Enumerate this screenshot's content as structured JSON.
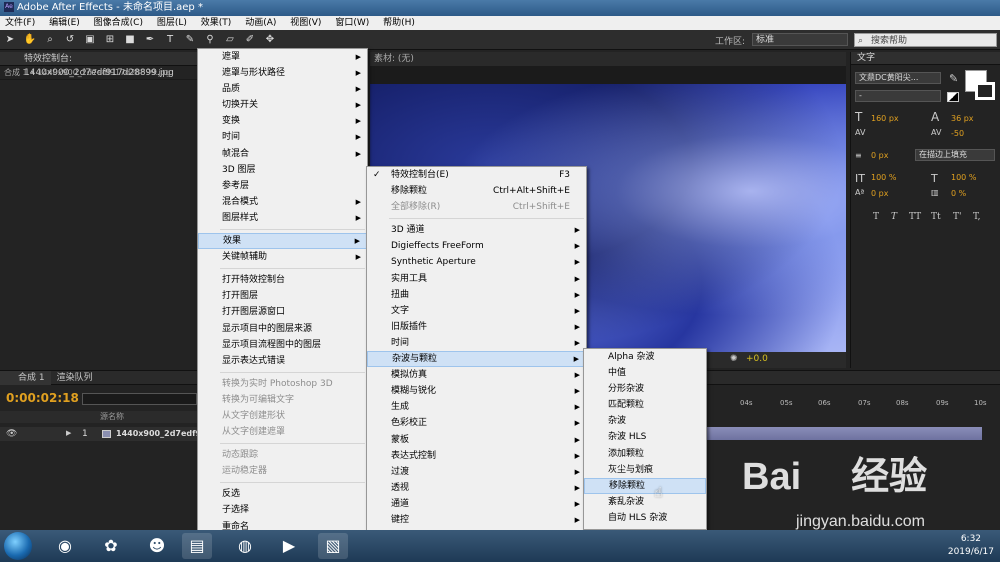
{
  "window": {
    "title": "Adobe After Effects - 未命名项目.aep *",
    "app_icon": "Ae"
  },
  "menubar": [
    "文件(F)",
    "编辑(E)",
    "图像合成(C)",
    "图层(L)",
    "效果(T)",
    "动画(A)",
    "视图(V)",
    "窗口(W)",
    "帮助(H)"
  ],
  "toolbar": {
    "workspace_label": "工作区:",
    "workspace_value": "标准",
    "search_placeholder": "搜索帮助"
  },
  "project": {
    "tab": "特效控制台: 1440x900_2d7edf917d28899.jpg",
    "sub": "合成 1 • 1440x900_2d7edf917d28899.jpg"
  },
  "viewer": {
    "header": "素材: (无)",
    "offset": "+0.0"
  },
  "text_panel": {
    "title": "文字",
    "font": "文鼎DC黄阳尖...",
    "style": "-",
    "size": "160 px",
    "leading": "36 px",
    "tracking": "-50",
    "stroke_width": "0 px",
    "stroke_mode": "在描边上填充",
    "vscale": "100 %",
    "hscale": "100 %",
    "baseline": "0 px",
    "tsume": "0 %",
    "styles": [
      "T",
      "T",
      "TT",
      "Tt",
      "T'",
      "T,"
    ]
  },
  "timeline": {
    "tabs": [
      "合成 1",
      "渲染队列"
    ],
    "timecode": "0:00:02:18",
    "col_source": "源名称",
    "layer_num": "1",
    "layer_name": "1440x900_2d7edf9",
    "ruler": [
      "04s",
      "05s",
      "06s",
      "07s",
      "08s",
      "09s",
      "10s"
    ]
  },
  "layer_menu": [
    {
      "label": "遮罩",
      "arrow": true
    },
    {
      "label": "遮罩与形状路径",
      "arrow": true
    },
    {
      "label": "品质",
      "arrow": true
    },
    {
      "label": "切换开关",
      "arrow": true
    },
    {
      "label": "变换",
      "arrow": true
    },
    {
      "label": "时间",
      "arrow": true
    },
    {
      "label": "帧混合",
      "arrow": true
    },
    {
      "label": "3D 图层"
    },
    {
      "label": "参考层"
    },
    {
      "label": "混合模式",
      "arrow": true
    },
    {
      "label": "图层样式",
      "arrow": true
    },
    {
      "sep": true
    },
    {
      "label": "效果",
      "arrow": true,
      "highlight": true
    },
    {
      "label": "关键帧辅助",
      "arrow": true
    },
    {
      "sep": true
    },
    {
      "label": "打开特效控制台"
    },
    {
      "label": "打开图层"
    },
    {
      "label": "打开图层源窗口"
    },
    {
      "label": "显示项目中的图层来源"
    },
    {
      "label": "显示项目流程图中的图层"
    },
    {
      "label": "显示表达式错误"
    },
    {
      "sep": true
    },
    {
      "label": "转换为实时 Photoshop 3D",
      "disabled": true
    },
    {
      "label": "转换为可编辑文字",
      "disabled": true
    },
    {
      "label": "从文字创建形状",
      "disabled": true
    },
    {
      "label": "从文字创建遮罩",
      "disabled": true
    },
    {
      "sep": true
    },
    {
      "label": "动态跟踪",
      "disabled": true
    },
    {
      "label": "运动稳定器",
      "disabled": true
    },
    {
      "sep": true
    },
    {
      "label": "反选"
    },
    {
      "label": "子选择"
    },
    {
      "label": "重命名"
    }
  ],
  "effect_menu": [
    {
      "label": "特效控制台(E)",
      "shortcut": "F3",
      "check": true
    },
    {
      "label": "移除颗粒",
      "shortcut": "Ctrl+Alt+Shift+E"
    },
    {
      "label": "全部移除(R)",
      "shortcut": "Ctrl+Shift+E",
      "disabled": true
    },
    {
      "sep": true
    },
    {
      "label": "3D 通道",
      "arrow": true
    },
    {
      "label": "Digieffects FreeForm",
      "arrow": true
    },
    {
      "label": "Synthetic Aperture",
      "arrow": true
    },
    {
      "label": "实用工具",
      "arrow": true
    },
    {
      "label": "扭曲",
      "arrow": true
    },
    {
      "label": "文字",
      "arrow": true
    },
    {
      "label": "旧版插件",
      "arrow": true
    },
    {
      "label": "时间",
      "arrow": true
    },
    {
      "label": "杂波与颗粒",
      "arrow": true,
      "highlight": true
    },
    {
      "label": "模拟仿真",
      "arrow": true
    },
    {
      "label": "模糊与锐化",
      "arrow": true
    },
    {
      "label": "生成",
      "arrow": true
    },
    {
      "label": "色彩校正",
      "arrow": true
    },
    {
      "label": "蒙板",
      "arrow": true
    },
    {
      "label": "表达式控制",
      "arrow": true
    },
    {
      "label": "过渡",
      "arrow": true
    },
    {
      "label": "透视",
      "arrow": true
    },
    {
      "label": "通道",
      "arrow": true
    },
    {
      "label": "键控",
      "arrow": true
    },
    {
      "label": "音频",
      "arrow": true
    },
    {
      "label": "风格化",
      "arrow": true
    }
  ],
  "noise_menu": [
    {
      "label": "Alpha 杂波"
    },
    {
      "label": "中值"
    },
    {
      "label": "分形杂波"
    },
    {
      "label": "匹配颗粒"
    },
    {
      "label": "杂波"
    },
    {
      "label": "杂波 HLS"
    },
    {
      "label": "添加颗粒"
    },
    {
      "label": "灰尘与划痕"
    },
    {
      "label": "移除颗粒",
      "highlight": true
    },
    {
      "label": "紊乱杂波"
    },
    {
      "label": "自动 HLS 杂波"
    }
  ],
  "taskbar": {
    "time": "6:32",
    "date": "2019/6/17"
  },
  "watermark": {
    "brand": "Bai",
    "brand2": "经验",
    "url": "jingyan.baidu.com"
  }
}
